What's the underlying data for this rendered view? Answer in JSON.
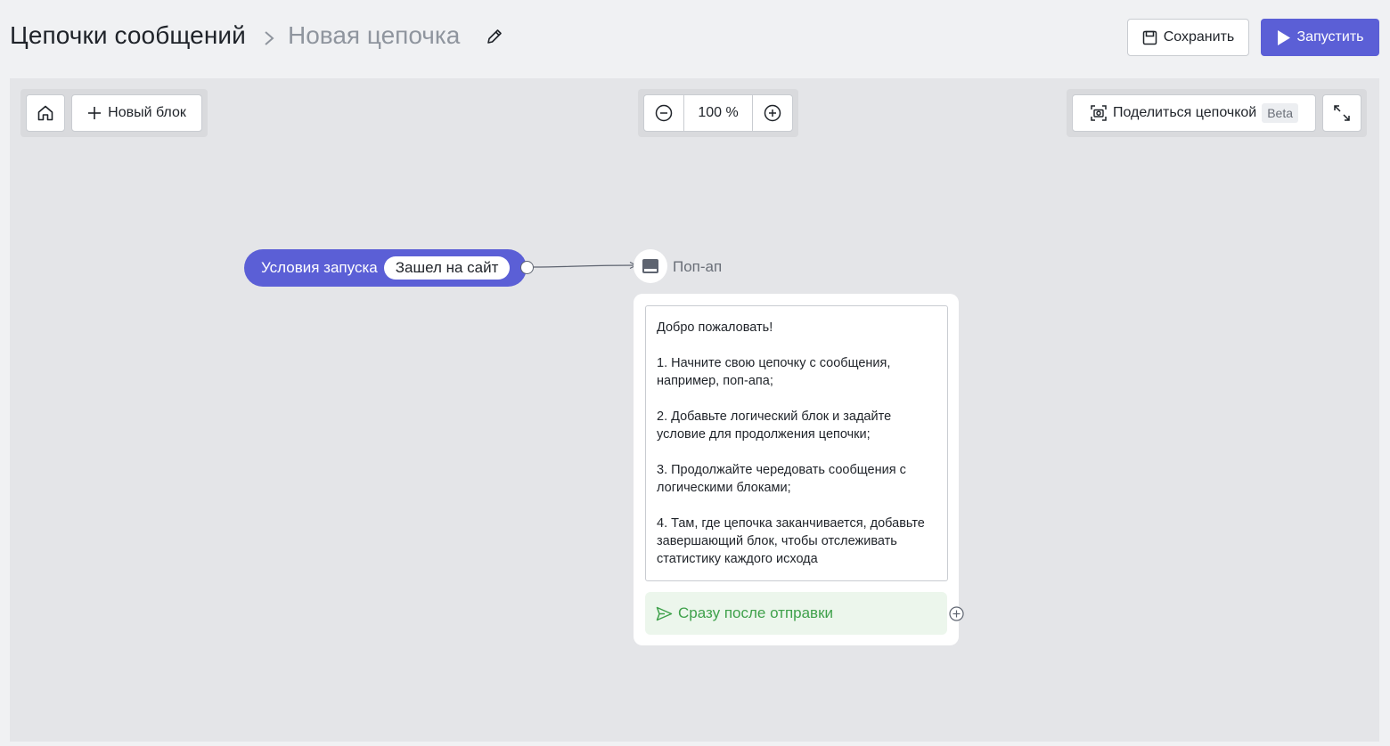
{
  "header": {
    "breadcrumb_root": "Цепочки сообщений",
    "breadcrumb_current": "Новая цепочка",
    "save_label": "Сохранить",
    "run_label": "Запустить"
  },
  "toolbar": {
    "new_block_label": "Новый блок",
    "zoom_value": "100 %",
    "share_label": "Поделиться цепочкой",
    "share_badge": "Beta"
  },
  "flow": {
    "trigger_label": "Условия запуска",
    "trigger_condition": "Зашел на сайт",
    "node_type_label": "Поп-ап",
    "message_lines": [
      "Добро пожаловать!",
      "",
      "1. Начните свою цепочку с сообщения, например, поп-апа;",
      "",
      "2. Добавьте логический блок и задайте условие для продолжения цепочки;",
      "",
      "3. Продолжайте чередовать сообщения с логическими блоками;",
      "",
      "4. Там, где цепочка заканчивается, добавьте завершающий блок, чтобы отслеживать статистику каждого исхода"
    ],
    "after_send_label": "Сразу после отправки"
  },
  "colors": {
    "accent": "#5b5fd6",
    "success": "#3fa14b",
    "canvas": "#e4e5e8"
  }
}
